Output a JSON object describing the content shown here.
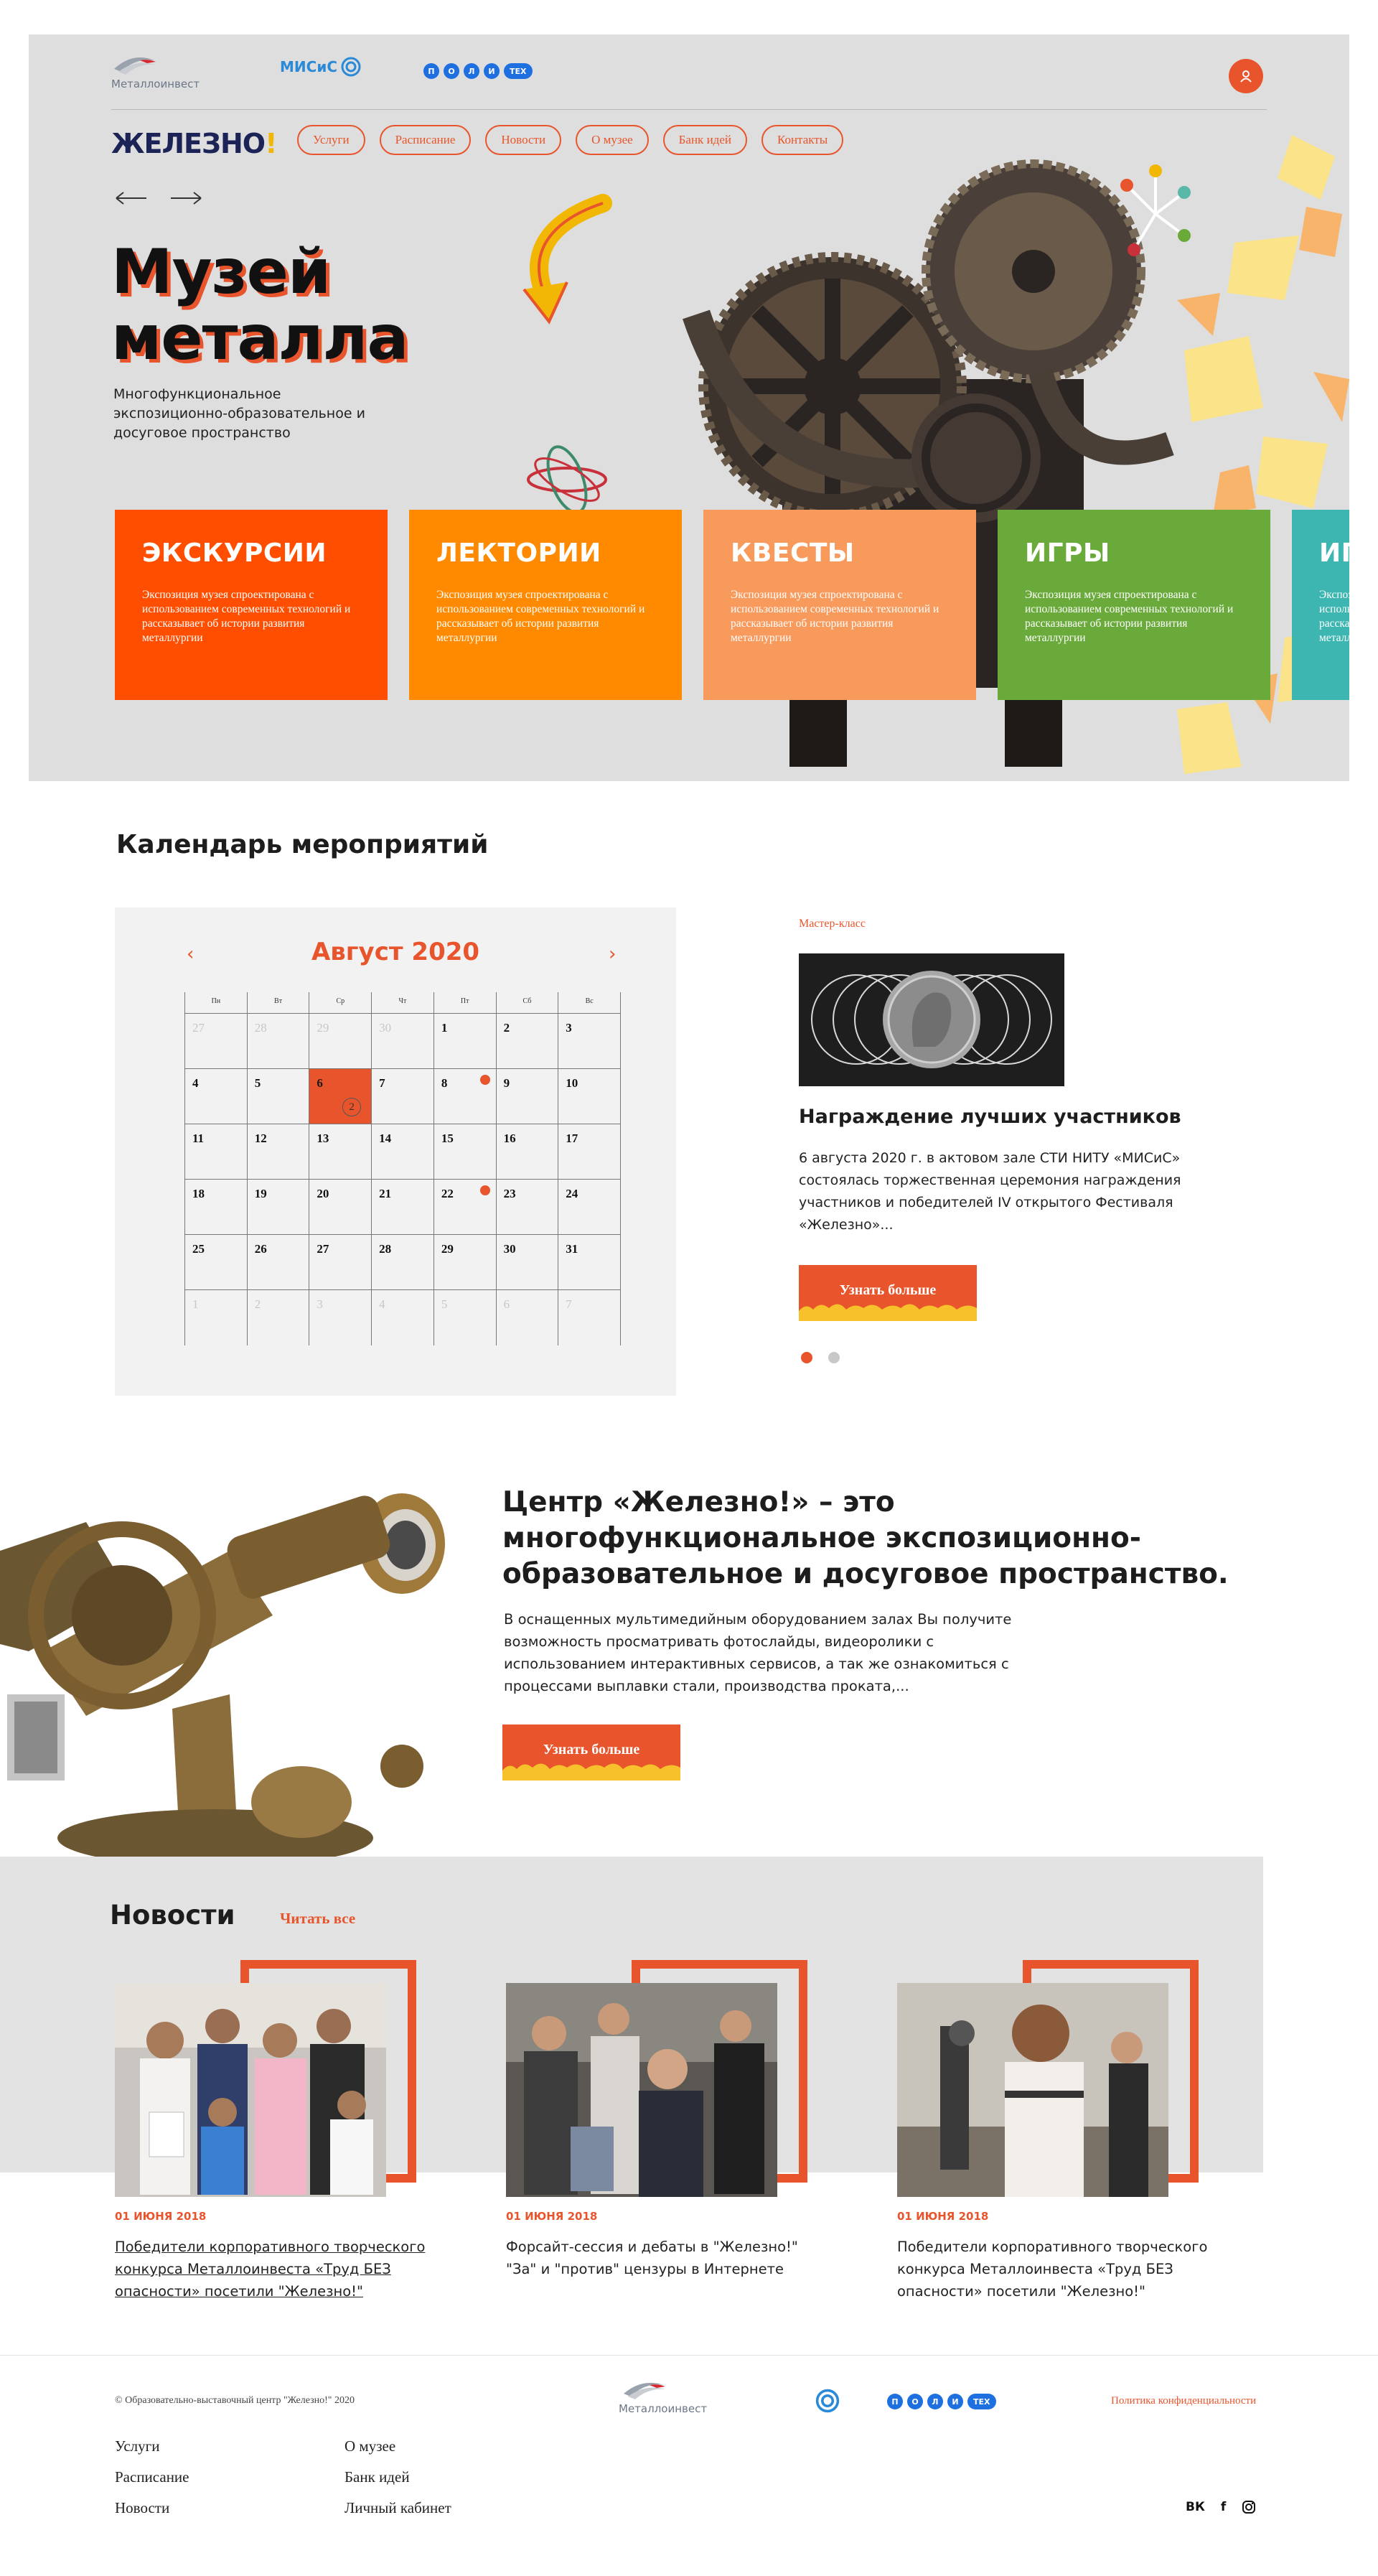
{
  "header": {
    "logo_metalloinvest": "Металлоинвест",
    "logo_misis": "МИСиС",
    "logo_politeh_letters": [
      "П",
      "О",
      "Л",
      "И"
    ],
    "logo_politeh_tex": "ТЕХ",
    "brand": "ЖЕЛЕЗНО",
    "brand_mark": "!",
    "nav": [
      "Услуги",
      "Расписание",
      "Новости",
      "О музее",
      "Банк идей",
      "Контакты"
    ]
  },
  "hero": {
    "title_line1": "Музей",
    "title_line2": "металла",
    "subtitle": "Многофункциональное экспозиционно-образовательное и досуговое пространство",
    "cards": [
      {
        "title": "ЭКСКУРСИИ",
        "text": "Экспозиция музея спроектирована с использованием современных технологий и рассказывает об истории развития металлургии"
      },
      {
        "title": "ЛЕКТОРИИ",
        "text": "Экспозиция музея спроектирована с использованием современных технологий и рассказывает об истории развития металлургии"
      },
      {
        "title": "КВЕСТЫ",
        "text": "Экспозиция музея спроектирована с использованием современных технологий и рассказывает об истории развития металлургии"
      },
      {
        "title": "ИГРЫ",
        "text": "Экспозиция музея спроектирована с использованием современных технологий и рассказывает об истории развития металлургии"
      },
      {
        "title": "ИГРЫ",
        "text": "Экспозиция музея спроектирована с использованием современных технологий и рассказывает об истории развития металлургии"
      }
    ]
  },
  "calendar": {
    "section_title": "Календарь мероприятий",
    "month": "Август 2020",
    "prev": "‹",
    "next": "›",
    "weekdays": [
      "Пн",
      "Вт",
      "Ср",
      "Чт",
      "Пт",
      "Сб",
      "Вс"
    ],
    "days": [
      {
        "n": "27",
        "m": true
      },
      {
        "n": "28",
        "m": true
      },
      {
        "n": "29",
        "m": true
      },
      {
        "n": "30",
        "m": true
      },
      {
        "n": "1"
      },
      {
        "n": "2"
      },
      {
        "n": "3"
      },
      {
        "n": "4"
      },
      {
        "n": "5"
      },
      {
        "n": "6",
        "sel": true,
        "count": "2"
      },
      {
        "n": "7"
      },
      {
        "n": "8",
        "mark": true
      },
      {
        "n": "9"
      },
      {
        "n": "10"
      },
      {
        "n": "11"
      },
      {
        "n": "12"
      },
      {
        "n": "13"
      },
      {
        "n": "14"
      },
      {
        "n": "15"
      },
      {
        "n": "16"
      },
      {
        "n": "17"
      },
      {
        "n": "18"
      },
      {
        "n": "19"
      },
      {
        "n": "20"
      },
      {
        "n": "21"
      },
      {
        "n": "22",
        "mark": true
      },
      {
        "n": "23"
      },
      {
        "n": "24"
      },
      {
        "n": "25"
      },
      {
        "n": "26"
      },
      {
        "n": "27"
      },
      {
        "n": "28"
      },
      {
        "n": "29"
      },
      {
        "n": "30"
      },
      {
        "n": "31"
      },
      {
        "n": "1",
        "m": true
      },
      {
        "n": "2",
        "m": true
      },
      {
        "n": "3",
        "m": true
      },
      {
        "n": "4",
        "m": true
      },
      {
        "n": "5",
        "m": true
      },
      {
        "n": "6",
        "m": true
      },
      {
        "n": "7",
        "m": true
      }
    ],
    "event": {
      "tag": "Мастер-класс",
      "title": "Награждение лучших участников",
      "text": "6 августа 2020 г. в актовом зале СТИ НИТУ «МИСиС» состоялась торжественная церемония награждения участников и победителей IV открытого Фестиваля «Железно»...",
      "button": "Узнать больше"
    }
  },
  "about": {
    "title": "Центр «Железно!» – это многофункциональное экспозиционно-образовательное и досуговое пространство.",
    "text": "В оснащенных мультимедийным оборудованием залах Вы получите возможность просматривать фотослайды, видеоролики с использованием интерактивных сервисов, а так же ознакомиться с процессами выплавки стали, производства проката,...",
    "button": "Узнать больше"
  },
  "news": {
    "title": "Новости",
    "read_all": "Читать все",
    "items": [
      {
        "date": "01 ИЮНЯ 2018",
        "text": "Победители корпоративного творческого конкурса Металлоинвеста «Труд БЕЗ опасности» посетили \"Железно!\""
      },
      {
        "date": "01 ИЮНЯ 2018",
        "text": "Форсайт-сессия и дебаты в \"Железно!\" \"За\" и \"против\" цензуры в Интернете"
      },
      {
        "date": "01 ИЮНЯ 2018",
        "text": "Победители корпоративного творческого конкурса Металлоинвеста «Труд БЕЗ опасности» посетили \"Железно!\""
      }
    ]
  },
  "footer": {
    "copyright": "© Образовательно-выставочный центр \"Железно!\" 2020",
    "logo_metalloinvest": "Металлоинвест",
    "privacy": "Политика конфиденциальности",
    "col1": [
      "Услуги",
      "Расписание",
      "Новости"
    ],
    "col2": [
      "О музее",
      "Банк идей",
      "Личный кабинет"
    ],
    "social_vk": "ВК",
    "social_fb": "f"
  },
  "colors": {
    "accent": "#e8552c",
    "brand_navy": "#1c2457",
    "hero_bg": "#dedede",
    "card_orange_red": "#ff4e00",
    "card_orange": "#ff8a00",
    "card_peach": "#f89a5c",
    "card_green": "#69aa3a",
    "card_teal": "#3db5b0"
  }
}
